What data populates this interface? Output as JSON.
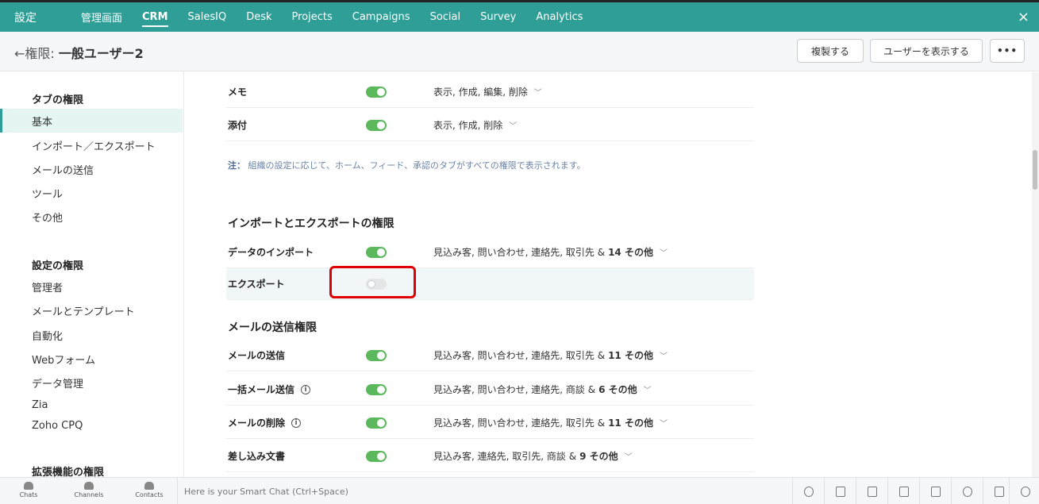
{
  "topnav": {
    "brand": "設定",
    "items": [
      "管理画面",
      "CRM",
      "SalesIQ",
      "Desk",
      "Projects",
      "Campaigns",
      "Social",
      "Survey",
      "Analytics"
    ],
    "active": "CRM",
    "close_icon": "×"
  },
  "header": {
    "back_arrow": "←",
    "title_prefix": "権限:",
    "title_name": "一般ユーザー2",
    "copy_button": "複製する",
    "show_users_button": "ユーザーを表示する",
    "more_button": "•••"
  },
  "sidebar": {
    "tab_section": "タブの権限",
    "tab_items": [
      "基本",
      "インポート／エクスポート",
      "メールの送信",
      "ツール",
      "その他"
    ],
    "settings_section": "設定の権限",
    "settings_items": [
      "管理者",
      "メールとテンプレート",
      "自動化",
      "Webフォーム",
      "データ管理",
      "Zia",
      "Zoho CPQ"
    ],
    "extension_section": "拡張機能の権限"
  },
  "main": {
    "rows_top": [
      {
        "label": "メモ",
        "enabled": true,
        "perms": "表示, 作成, 編集, 削除",
        "more": ""
      },
      {
        "label": "添付",
        "enabled": true,
        "perms": "表示, 作成, 削除",
        "more": ""
      }
    ],
    "note_prefix": "注：",
    "note_text": "組織の設定に応じて、ホーム、フィード、承認のタブがすべての権限で表示されます。",
    "import_export_heading": "インポートとエクスポートの権限",
    "import_rows": [
      {
        "label": "データのインポート",
        "enabled": true,
        "perms": "見込み客, 問い合わせ, 連絡先, 取引先 &",
        "more": "14 その他"
      },
      {
        "label": "エクスポート",
        "enabled": false,
        "perms": "",
        "more": ""
      }
    ],
    "mail_heading": "メールの送信権限",
    "mail_rows": [
      {
        "label": "メールの送信",
        "info": false,
        "enabled": true,
        "perms": "見込み客, 問い合わせ, 連絡先, 取引先 &",
        "more": "11 その他"
      },
      {
        "label": "一括メール送信",
        "info": true,
        "enabled": true,
        "perms": "見込み客, 問い合わせ, 連絡先, 商談 &",
        "more": "6 その他"
      },
      {
        "label": "メールの削除",
        "info": true,
        "enabled": true,
        "perms": "見込み客, 問い合わせ, 連絡先, 取引先 &",
        "more": "11 その他"
      },
      {
        "label": "差し込み文書",
        "info": false,
        "enabled": true,
        "perms": "見込み客, 連絡先, 取引先, 商談 &",
        "more": "9 その他"
      }
    ]
  },
  "bottombar": {
    "items": [
      "Chats",
      "Channels",
      "Contacts"
    ],
    "chat_placeholder": "Here is your Smart Chat (Ctrl+Space)",
    "tool_icons": [
      "whatsapp-icon",
      "screen-share-icon",
      "translate-icon",
      "notes-icon",
      "contact-card-icon",
      "alarm-icon",
      "announcement-icon",
      "coffee-icon"
    ]
  },
  "colors": {
    "accent": "#2e9e96",
    "toggle_on": "#5cb85c",
    "highlight_box": "#e00000"
  }
}
